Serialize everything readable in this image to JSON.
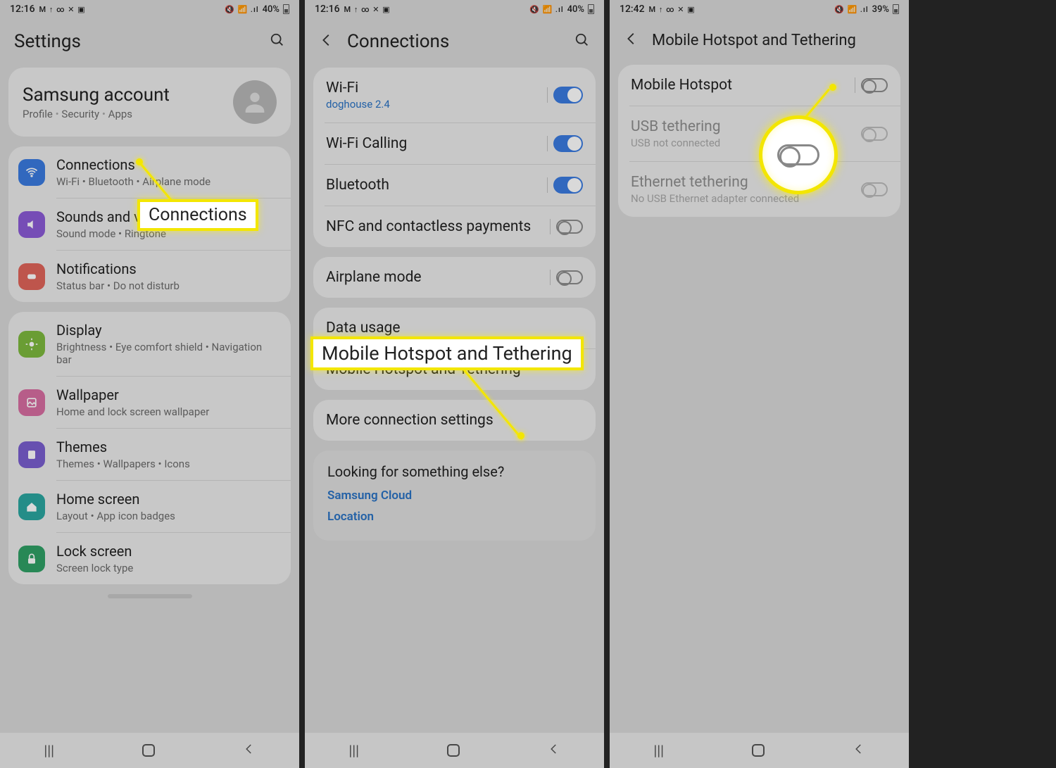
{
  "screens": [
    {
      "statusbar": {
        "time": "12:16",
        "icons_left": "M ↑ ∞ ✕ ▣",
        "icons_right": "🔇 📶 .ıl",
        "battery": "40%"
      },
      "header": {
        "title": "Settings"
      },
      "account": {
        "title": "Samsung account",
        "sub1": "Profile",
        "sub2": "Security",
        "sub3": "Apps"
      },
      "items": [
        {
          "title": "Connections",
          "sub": "Wi-Fi  •  Bluetooth  •  Airplane mode",
          "bg": "#3a7be0",
          "icon": "wifi"
        },
        {
          "title": "Sounds and vibration",
          "sub": "Sound mode  •  Ringtone",
          "bg": "#8b5bd6",
          "icon": "sound"
        },
        {
          "title": "Notifications",
          "sub": "Status bar  •  Do not disturb",
          "bg": "#e0645a",
          "icon": "notif"
        },
        {
          "title": "Display",
          "sub": "Brightness  •  Eye comfort shield  •  Navigation bar",
          "bg": "#7db93e",
          "icon": "display"
        },
        {
          "title": "Wallpaper",
          "sub": "Home and lock screen wallpaper",
          "bg": "#d76ea1",
          "icon": "wall"
        },
        {
          "title": "Themes",
          "sub": "Themes  •  Wallpapers  •  Icons",
          "bg": "#7a5fcf",
          "icon": "theme"
        },
        {
          "title": "Home screen",
          "sub": "Layout  •  App icon badges",
          "bg": "#2ba6a0",
          "icon": "home"
        },
        {
          "title": "Lock screen",
          "sub": "Screen lock type",
          "bg": "#2fa065",
          "icon": "lock"
        }
      ],
      "callout": {
        "label": "Connections"
      }
    },
    {
      "statusbar": {
        "time": "12:16",
        "icons_left": "M ↑ ∞ ✕ ▣",
        "icons_right": "🔇 📶 .ıl",
        "battery": "40%"
      },
      "header": {
        "title": "Connections"
      },
      "group1": [
        {
          "title": "Wi-Fi",
          "sub": "doghouse 2.4",
          "subBlue": true,
          "toggle": "on"
        },
        {
          "title": "Wi-Fi Calling",
          "toggle": "on"
        },
        {
          "title": "Bluetooth",
          "toggle": "on"
        },
        {
          "title": "NFC and contactless payments",
          "toggle": "off"
        }
      ],
      "group2": [
        {
          "title": "Airplane mode",
          "toggle": "off"
        }
      ],
      "group3": [
        {
          "title": "Data usage"
        },
        {
          "title": "Mobile Hotspot and Tethering"
        }
      ],
      "group4": [
        {
          "title": "More connection settings"
        }
      ],
      "footer": {
        "q": "Looking for something else?",
        "links": [
          "Samsung Cloud",
          "Location"
        ]
      },
      "callout": {
        "label": "Mobile Hotspot and Tethering"
      }
    },
    {
      "statusbar": {
        "time": "12:42",
        "icons_left": "M ↑ ∞ ✕ ▣",
        "icons_right": "🔇 📶 .ıl",
        "battery": "39%"
      },
      "header": {
        "title": "Mobile Hotspot and Tethering"
      },
      "items": [
        {
          "title": "Mobile Hotspot",
          "toggle": "off",
          "enabled": true
        },
        {
          "title": "USB tethering",
          "sub": "USB not connected",
          "toggle": "off",
          "enabled": false
        },
        {
          "title": "Ethernet tethering",
          "sub": "No USB Ethernet adapter connected",
          "toggle": "off",
          "enabled": false
        }
      ]
    }
  ]
}
